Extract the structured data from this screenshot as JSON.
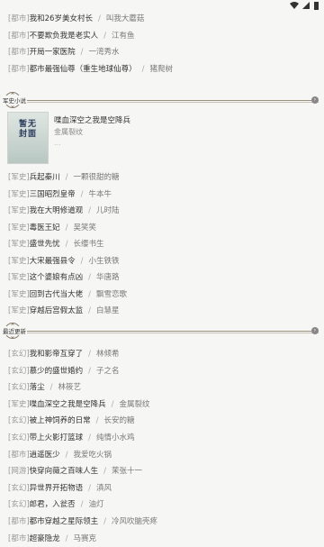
{
  "top_list": [
    {
      "category": "[都市]",
      "title": "我和26岁美女村长",
      "author": "叫我大蘑菇"
    },
    {
      "category": "[都市]",
      "title": "不要欺负我是老实人",
      "author": "江有鱼"
    },
    {
      "category": "[都市]",
      "title": "开局一家医院",
      "author": "一湾秀水"
    },
    {
      "category": "[都市]",
      "title": "都市最强仙尊（重生地球仙尊）",
      "author": "猪爬树"
    }
  ],
  "military_section": {
    "label": "军史小说",
    "featured": {
      "title": "喋血深空之我是空降兵",
      "author": "金属裂纹",
      "more": "...",
      "cover_text": "暂无封面"
    },
    "list": [
      {
        "category": "[军史]",
        "title": "兵起秦川",
        "author": "一颗很甜的糖"
      },
      {
        "category": "[军史]",
        "title": "三国昭烈皇帝",
        "author": "牛本牛"
      },
      {
        "category": "[军史]",
        "title": "我在大明修道观",
        "author": "儿时陆"
      },
      {
        "category": "[军史]",
        "title": "毒医王妃",
        "author": "吴笑笑"
      },
      {
        "category": "[军史]",
        "title": "盛世先忧",
        "author": "长缨书生"
      },
      {
        "category": "[军史]",
        "title": "大宋最强县令",
        "author": "小生铁铁"
      },
      {
        "category": "[军史]",
        "title": "这个婆娘有点凶",
        "author": "华唐路"
      },
      {
        "category": "[军史]",
        "title": "回到古代当大佬",
        "author": "飘雪恋歌"
      },
      {
        "category": "[军史]",
        "title": "穿越后宫假太监",
        "author": "白慧星"
      }
    ]
  },
  "recent_section": {
    "label": "最近更新",
    "list": [
      {
        "category": "[玄幻]",
        "title": "我和影帝互穿了",
        "author": "林倾希"
      },
      {
        "category": "[玄幻]",
        "title": "慕少的盛世婚约",
        "author": "子之名"
      },
      {
        "category": "[玄幻]",
        "title": "落尘",
        "author": "林筱艺"
      },
      {
        "category": "[军史]",
        "title": "喋血深空之我是空降兵",
        "author": "金属裂纹"
      },
      {
        "category": "[玄幻]",
        "title": "被上神饲养的日常",
        "author": "长安的糖"
      },
      {
        "category": "[玄幻]",
        "title": "带上火影打篮球",
        "author": "纯情小水鸡"
      },
      {
        "category": "[都市]",
        "title": "逍遥医少",
        "author": "我爱吃火锅"
      },
      {
        "category": "[网游]",
        "title": "快穿向薇之百味人生",
        "author": "茉张十一"
      },
      {
        "category": "[玄幻]",
        "title": "异世界开拓物语",
        "author": "滇风"
      },
      {
        "category": "[玄幻]",
        "title": "郎君，入瓮否",
        "author": "油灯"
      },
      {
        "category": "[都市]",
        "title": "都市穿越之星际领主",
        "author": "冷风吹脑壳疼"
      },
      {
        "category": "[都市]",
        "title": "超豪隐龙",
        "author": "马赛克"
      }
    ]
  },
  "colors": {
    "background": "#f6f6f4",
    "divider": "#9a9080",
    "category": "#999999"
  }
}
